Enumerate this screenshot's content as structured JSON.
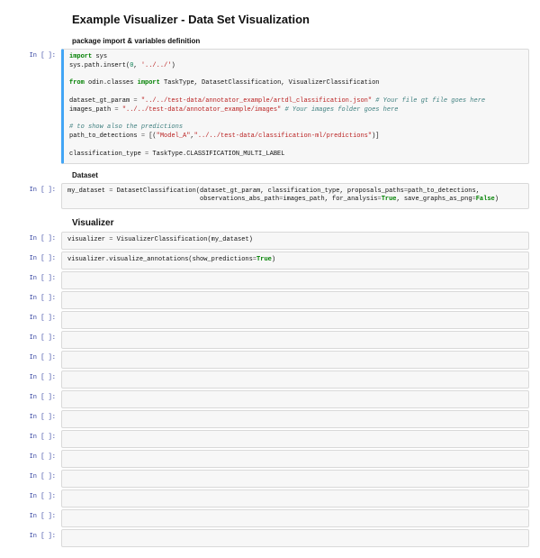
{
  "title": "Example Visualizer - Data Set Visualization",
  "sections": {
    "pkg": "package import & variables definition",
    "dataset": "Dataset",
    "visualizer": "Visualizer"
  },
  "prompts": {
    "in": "In [ ]:"
  },
  "code": {
    "cell1": {
      "l1a": "import",
      "l1b": " sys",
      "l2a": "sys.path.insert(",
      "l2num": "0",
      "l2b": ", ",
      "l2str": "'../../'",
      "l2c": ")",
      "l3a": "from",
      "l3b": " odin.classes ",
      "l3c": "import",
      "l3d": " TaskType, DatasetClassification, VisualizerClassification",
      "l4a": "dataset_gt_param ",
      "l4eq": "=",
      "l4b": " ",
      "l4str": "\"../../test-data/annotator_example/artdl_classification.json\"",
      "l4c": " ",
      "l4cmt": "# Your file gt file goes here",
      "l5a": "images_path ",
      "l5eq": "=",
      "l5b": " ",
      "l5str": "\"../../test-data/annotator_example/images\"",
      "l5c": " ",
      "l5cmt": "# Your images folder goes here",
      "l6cmt": "# to show also the predictions",
      "l7a": "path_to_detections ",
      "l7eq": "=",
      "l7b": " [(",
      "l7s1": "\"Model_A\"",
      "l7c": ",",
      "l7s2": "\"../../test-data/classification-ml/predictions\"",
      "l7d": ")]",
      "l8a": "classification_type ",
      "l8eq": "=",
      "l8b": " TaskType.CLASSIFICATION_MULTI_LABEL"
    },
    "cell2": {
      "l1a": "my_dataset ",
      "l1eq": "=",
      "l1b": " DatasetClassification(dataset_gt_param, classification_type, proposals_paths",
      "l1eq2": "=",
      "l1c": "path_to_detections,",
      "l2pad": "                                   ",
      "l2a": "observations_abs_path",
      "l2eq": "=",
      "l2b": "images_path, for_analysis",
      "l2eq2": "=",
      "l2bool": "True",
      "l2c": ", save_graphs_as_png",
      "l2eq3": "=",
      "l2bool2": "False",
      "l2d": ")"
    },
    "cell3": {
      "l1a": "visualizer ",
      "l1eq": "=",
      "l1b": " VisualizerClassification(my_dataset)"
    },
    "cell4": {
      "l1a": "visualizer.visualize_annotations(show_predictions",
      "l1eq": "=",
      "l1bool": "True",
      "l1b": ")"
    }
  }
}
